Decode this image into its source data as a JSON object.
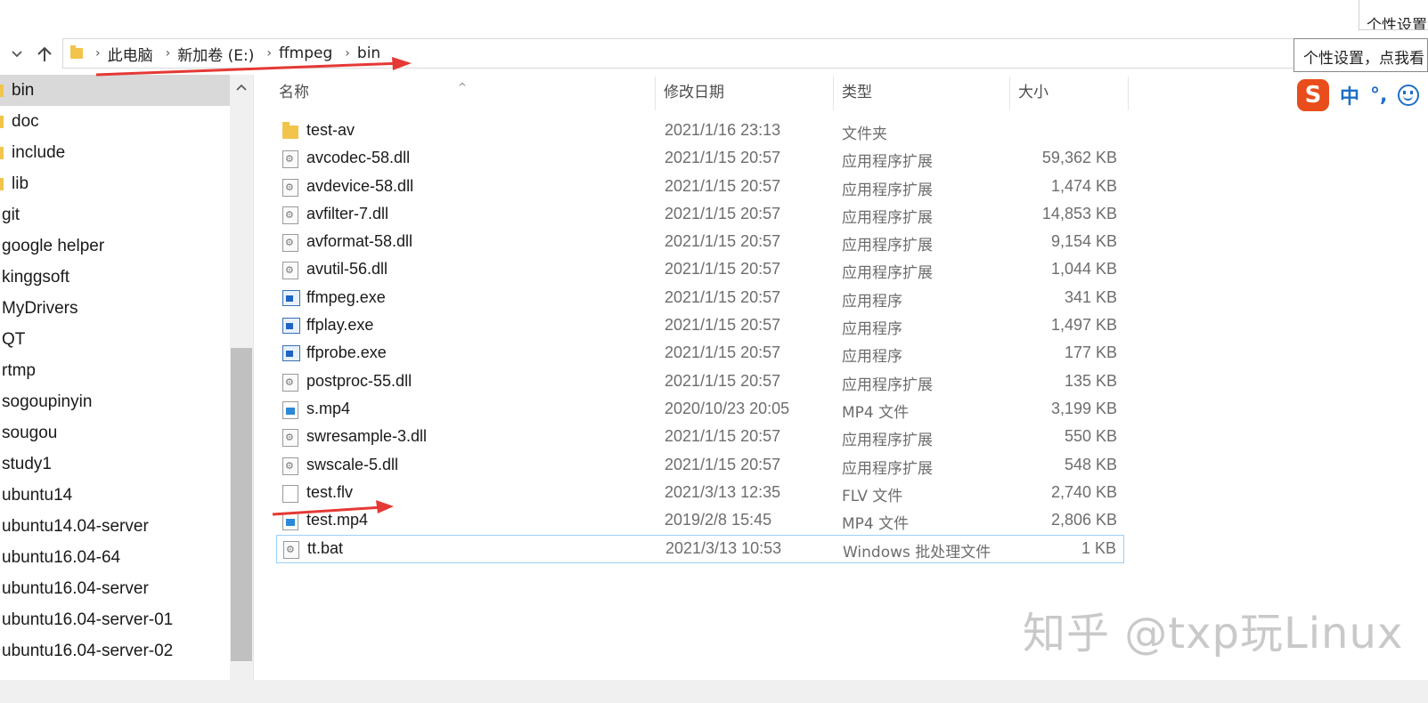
{
  "corner_tab": "个性设置",
  "breadcrumb": [
    "此电脑",
    "新加卷 (E:)",
    "ffmpeg",
    "bin"
  ],
  "tooltip": "个性设置，点我看",
  "ime": {
    "logo": "S",
    "mode": "中",
    "punct": "°,",
    "icon": "smile-icon"
  },
  "sidebar": {
    "items": [
      {
        "label": "bin",
        "selected": true,
        "indented": true
      },
      {
        "label": "doc",
        "indented": true
      },
      {
        "label": "include",
        "indented": true
      },
      {
        "label": "lib",
        "indented": true
      },
      {
        "label": "git"
      },
      {
        "label": "google helper"
      },
      {
        "label": "kinggsoft"
      },
      {
        "label": "MyDrivers"
      },
      {
        "label": "QT"
      },
      {
        "label": "rtmp"
      },
      {
        "label": "sogoupinyin"
      },
      {
        "label": "sougou"
      },
      {
        "label": "study1"
      },
      {
        "label": "ubuntu14"
      },
      {
        "label": "ubuntu14.04-server"
      },
      {
        "label": "ubuntu16.04-64"
      },
      {
        "label": "ubuntu16.04-server"
      },
      {
        "label": "ubuntu16.04-server-01"
      },
      {
        "label": "ubuntu16.04-server-02"
      }
    ]
  },
  "columns": {
    "name": "名称",
    "date": "修改日期",
    "type": "类型",
    "size": "大小"
  },
  "files": [
    {
      "name": "test-av",
      "date": "2021/1/16 23:13",
      "type": "文件夹",
      "size": "",
      "icon": "folder"
    },
    {
      "name": "avcodec-58.dll",
      "date": "2021/1/15 20:57",
      "type": "应用程序扩展",
      "size": "59,362 KB",
      "icon": "dll"
    },
    {
      "name": "avdevice-58.dll",
      "date": "2021/1/15 20:57",
      "type": "应用程序扩展",
      "size": "1,474 KB",
      "icon": "dll"
    },
    {
      "name": "avfilter-7.dll",
      "date": "2021/1/15 20:57",
      "type": "应用程序扩展",
      "size": "14,853 KB",
      "icon": "dll"
    },
    {
      "name": "avformat-58.dll",
      "date": "2021/1/15 20:57",
      "type": "应用程序扩展",
      "size": "9,154 KB",
      "icon": "dll"
    },
    {
      "name": "avutil-56.dll",
      "date": "2021/1/15 20:57",
      "type": "应用程序扩展",
      "size": "1,044 KB",
      "icon": "dll"
    },
    {
      "name": "ffmpeg.exe",
      "date": "2021/1/15 20:57",
      "type": "应用程序",
      "size": "341 KB",
      "icon": "exe"
    },
    {
      "name": "ffplay.exe",
      "date": "2021/1/15 20:57",
      "type": "应用程序",
      "size": "1,497 KB",
      "icon": "exe"
    },
    {
      "name": "ffprobe.exe",
      "date": "2021/1/15 20:57",
      "type": "应用程序",
      "size": "177 KB",
      "icon": "exe"
    },
    {
      "name": "postproc-55.dll",
      "date": "2021/1/15 20:57",
      "type": "应用程序扩展",
      "size": "135 KB",
      "icon": "dll"
    },
    {
      "name": "s.mp4",
      "date": "2020/10/23 20:05",
      "type": "MP4 文件",
      "size": "3,199 KB",
      "icon": "mp4"
    },
    {
      "name": "swresample-3.dll",
      "date": "2021/1/15 20:57",
      "type": "应用程序扩展",
      "size": "550 KB",
      "icon": "dll"
    },
    {
      "name": "swscale-5.dll",
      "date": "2021/1/15 20:57",
      "type": "应用程序扩展",
      "size": "548 KB",
      "icon": "dll"
    },
    {
      "name": "test.flv",
      "date": "2021/3/13 12:35",
      "type": "FLV 文件",
      "size": "2,740 KB",
      "icon": "file"
    },
    {
      "name": "test.mp4",
      "date": "2019/2/8 15:45",
      "type": "MP4 文件",
      "size": "2,806 KB",
      "icon": "mp4"
    },
    {
      "name": "tt.bat",
      "date": "2021/3/13 10:53",
      "type": "Windows 批处理文件",
      "size": "1 KB",
      "icon": "dll",
      "focused": true
    }
  ],
  "watermark": "知乎 @txp玩Linux",
  "colors": {
    "annotation_arrow": "#e53935",
    "selection": "#d9d9d9",
    "focus_border": "#99d1ff"
  }
}
